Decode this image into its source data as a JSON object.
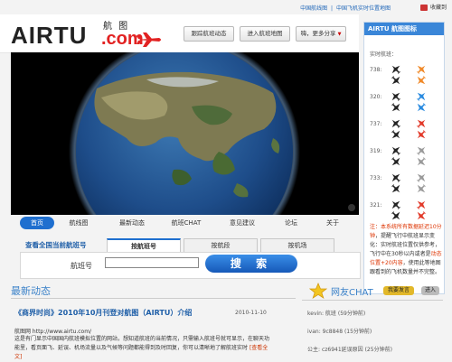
{
  "topbar": {
    "links": [
      "中国航线图",
      "|",
      "中国飞机实时位置地图"
    ],
    "bookmark": "收藏到"
  },
  "header": {
    "logo": "AIRTU",
    "logo_com": ".com",
    "logo_cn": "航 图",
    "buttons": [
      "跟踪航班动态",
      "进入航班地图",
      "嗨，更多分享"
    ]
  },
  "tabs": [
    "首页",
    "航线图",
    "最新动态",
    "航班CHAT",
    "意见建议",
    "论坛",
    "关于"
  ],
  "search": {
    "heading": "查看全国当前航班号",
    "subtabs": [
      "按航班号",
      "按航段",
      "按机场"
    ],
    "label": "航班号",
    "input_value": "",
    "button": "搜 索"
  },
  "news": {
    "title": "最新动态",
    "headline": "《商界时尚》2010年10月刊登对航图（AIRTU）介绍",
    "date": "2010-11-10",
    "url_line": "航图网 http://www.airtu.com/",
    "body": "这是有门显示中国国内航班模拟位置的网站，想知道航班的当前情况，只需输入航班号就可显示，在聊天功能里，看页面飞、延误、机场流量以及气候等问题都能得到及时回复，你可以清晰地了解航班实时",
    "more": "[查看全文]"
  },
  "right": {
    "title": "AIRTU 航图图标",
    "subtitle": "实时航班：",
    "rows": [
      {
        "label": "738:",
        "variant": "orange"
      },
      {
        "label": "320:",
        "variant": "blue"
      },
      {
        "label": "737:",
        "variant": "red"
      },
      {
        "label": "319:",
        "variant": "plain"
      },
      {
        "label": "733:",
        "variant": "plain"
      },
      {
        "label": "321:",
        "variant": "red"
      }
    ],
    "notice_parts": [
      "注：本系统所有数据",
      "延迟10分钟",
      "，提醒飞行中航班显示变化：",
      "实时航班位置仅供参考，",
      "飞行中在30秒以内或者是",
      "动态位置+20内容",
      "，使用此等地图跟看到的飞机数量并不完整。"
    ]
  },
  "chat": {
    "title": "网友CHAT",
    "btn1": "我要发言",
    "btn2": "进入",
    "lines": [
      {
        "user": "kevin",
        "msg": "航班",
        "time": "(59分钟前)"
      },
      {
        "user": "ivan",
        "msg": "9c8848",
        "time": "(15分钟前)"
      },
      {
        "user": "公主",
        "msg": "cz6941延误原因",
        "time": "(25分钟前)"
      }
    ]
  },
  "colors": {
    "brand_red": "#e22222",
    "primary_blue": "#1f6fcf",
    "link_blue": "#1f66b8"
  }
}
